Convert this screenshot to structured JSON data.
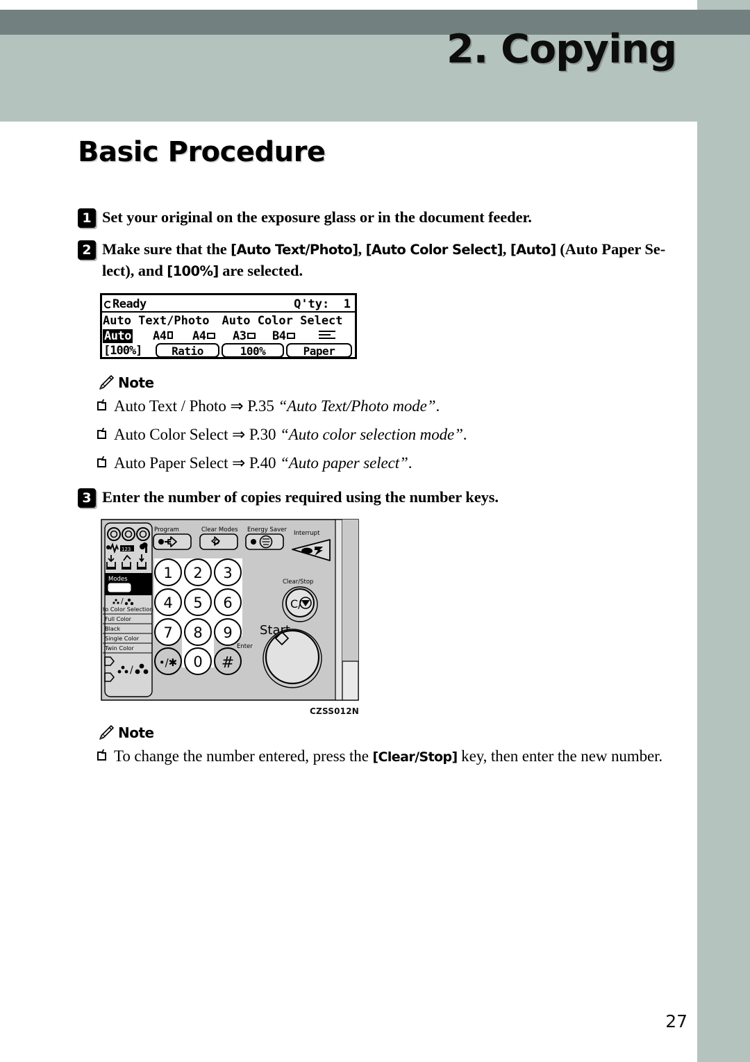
{
  "header": {
    "chapter_title": "2. Copying",
    "band_dark_color": "#72817f",
    "band_light_color": "#b4c3be"
  },
  "section": {
    "title": "Basic Procedure"
  },
  "steps": [
    {
      "number": "1",
      "text": "Set your original on the exposure glass or in the document feeder."
    },
    {
      "number": "2",
      "text_parts": {
        "p1": "Make sure that the ",
        "k1": "[Auto Text/Photo]",
        "p2": ", ",
        "k2": "[Auto Color Select]",
        "p3": ", ",
        "k3": "[Auto]",
        "p4": " (Auto Paper Se-",
        "p5": "lect), and ",
        "k4": "[100%]",
        "p6": " are selected."
      }
    },
    {
      "number": "3",
      "text": "Enter the number of copies required using the number keys."
    }
  ],
  "lcd": {
    "status": "Ready",
    "qty_label": "Q'ty:",
    "qty_value": "1",
    "mode_text": "Auto Text/Photo",
    "mode_text2": "Auto Color Select",
    "paper_auto": "Auto",
    "paper_sizes": [
      {
        "label": "A4",
        "orientation": "portrait"
      },
      {
        "label": "A4",
        "orientation": "landscape"
      },
      {
        "label": "A3",
        "orientation": "landscape"
      },
      {
        "label": "B4",
        "orientation": "landscape"
      }
    ],
    "zoom_display": "[100%]",
    "buttons": [
      "Ratio",
      "100%",
      "Paper"
    ]
  },
  "note1": {
    "label": "Note",
    "items": [
      {
        "lead": "Auto Text / Photo ⇒ P.35 ",
        "ref": "“Auto Text/Photo mode”",
        "tail": "."
      },
      {
        "lead": "Auto Color Select ⇒ P.30 ",
        "ref": "“Auto color selection mode”",
        "tail": "."
      },
      {
        "lead": "Auto Paper Select ⇒ P.40 ",
        "ref": "“Auto paper select”",
        "tail": "."
      }
    ]
  },
  "note2": {
    "label": "Note",
    "item": {
      "lead": "To change the number entered, press the ",
      "key": "[Clear/Stop]",
      "tail": " key, then enter the new number."
    }
  },
  "figure": {
    "code": "CZSS012N",
    "button_labels": {
      "program": "Program",
      "clear_modes": "Clear Modes",
      "energy_saver": "Energy Saver",
      "interrupt": "Interrupt",
      "clear_stop": "Clear/Stop",
      "clear_stop_glyph": "C/",
      "start": "Start",
      "enter": "Enter",
      "modes": "Modes",
      "asterisk": "•/∗",
      "hash": "#"
    },
    "keypad": [
      "1",
      "2",
      "3",
      "4",
      "5",
      "6",
      "7",
      "8",
      "9",
      "0"
    ],
    "color_selection": {
      "title": "to Color Selection",
      "options": [
        "Full Color",
        "Black",
        "Single Color",
        "Twin Color"
      ]
    }
  },
  "folio": {
    "page_number": "27"
  }
}
